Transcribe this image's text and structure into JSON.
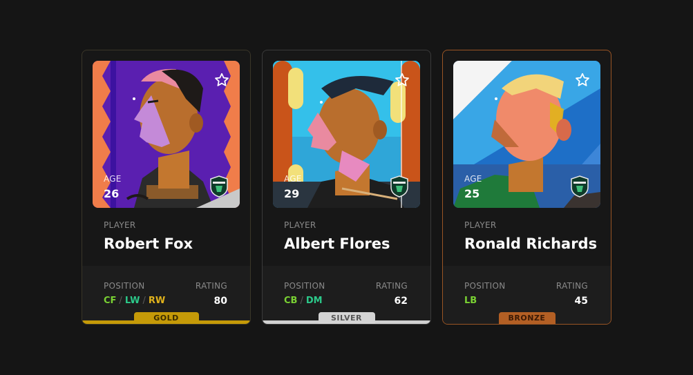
{
  "cards": [
    {
      "name": "Robert Fox",
      "player_label": "PLAYER",
      "age_label": "AGE",
      "age": "26",
      "position_label": "POSITION",
      "positions": [
        "CF",
        "LW",
        "RW"
      ],
      "position_colors": [
        "#7ad233",
        "#2cc98a",
        "#e0b21c"
      ],
      "rating_label": "RATING",
      "rating": "80",
      "tier": "GOLD",
      "favorite_icon": "star-outline-icon",
      "crest_icon": "club-crest-icon"
    },
    {
      "name": "Albert Flores",
      "player_label": "PLAYER",
      "age_label": "AGE",
      "age": "29",
      "position_label": "POSITION",
      "positions": [
        "CB",
        "DM"
      ],
      "position_colors": [
        "#7ad233",
        "#2cc98a"
      ],
      "rating_label": "RATING",
      "rating": "62",
      "tier": "SILVER",
      "favorite_icon": "star-outline-icon",
      "crest_icon": "club-crest-icon"
    },
    {
      "name": "Ronald Richards",
      "player_label": "PLAYER",
      "age_label": "AGE",
      "age": "25",
      "position_label": "POSITION",
      "positions": [
        "LB"
      ],
      "position_colors": [
        "#7ad233"
      ],
      "rating_label": "RATING",
      "rating": "45",
      "tier": "BRONZE",
      "favorite_icon": "star-outline-icon",
      "crest_icon": "club-crest-icon"
    }
  ],
  "colors": {
    "background": "#151515",
    "card": "#171717",
    "stats_panel": "#1d1d1d",
    "gold": "#c59a08",
    "silver": "#d4d4d4",
    "bronze": "#b35f24"
  }
}
